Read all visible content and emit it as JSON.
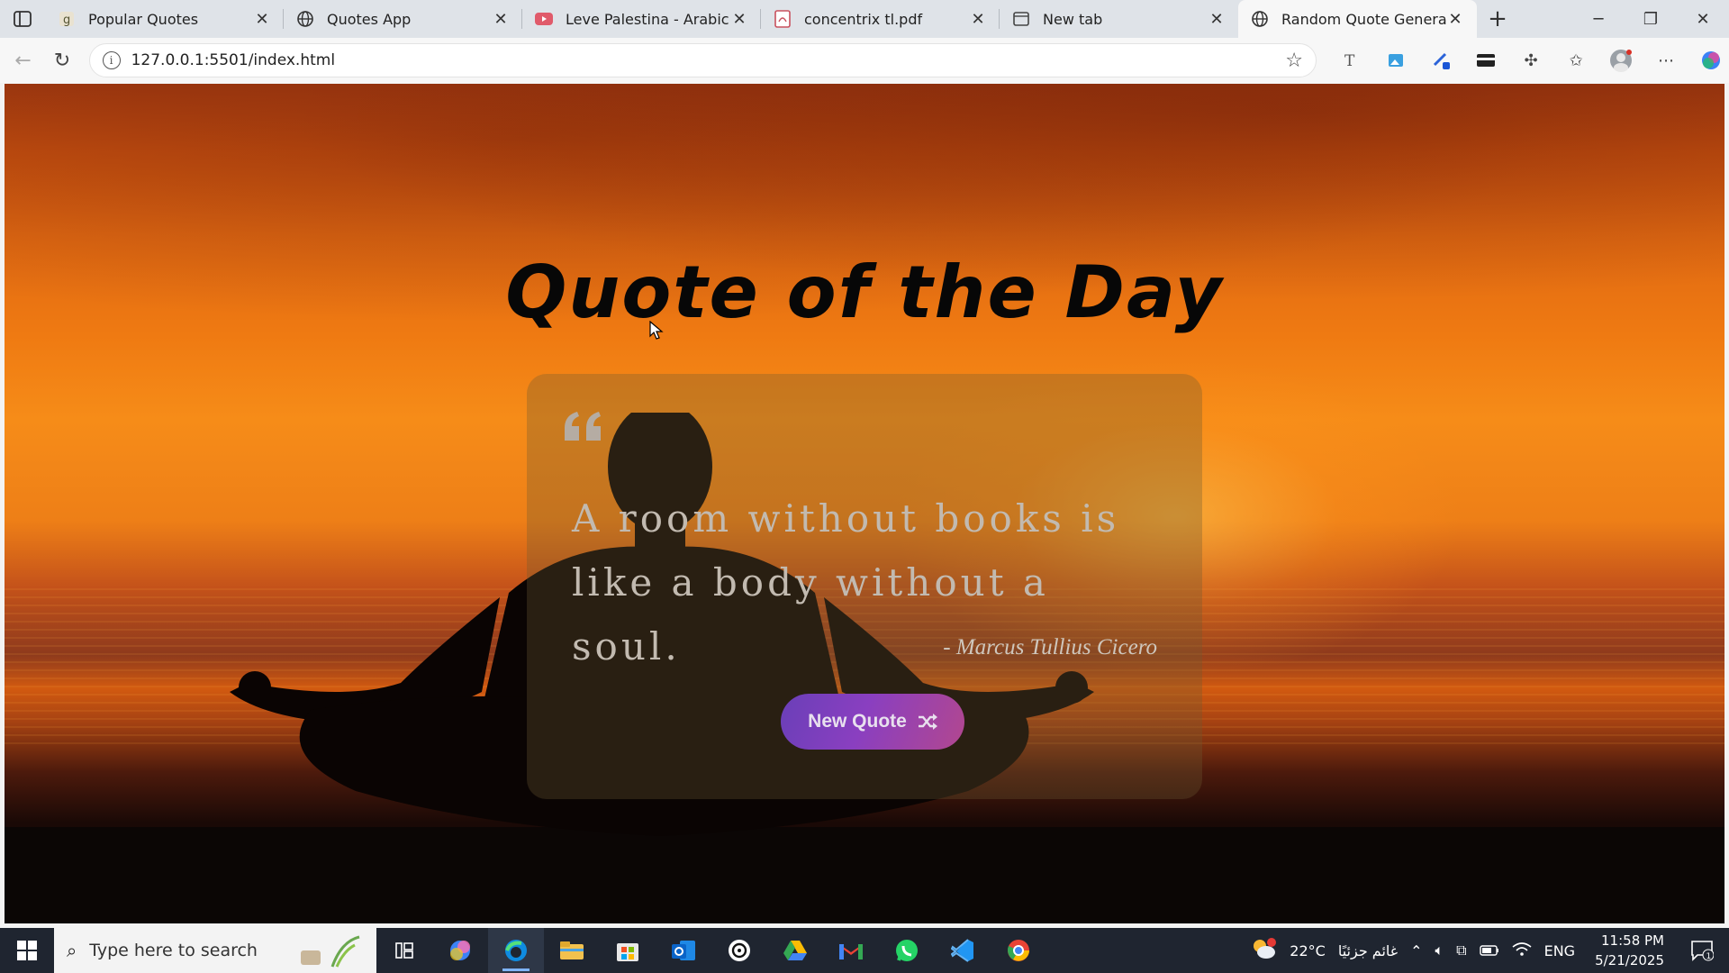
{
  "browser": {
    "tabs": [
      {
        "title": "Popular Quotes",
        "favicon": "goodreads-icon",
        "active": false
      },
      {
        "title": "Quotes App",
        "favicon": "globe-icon",
        "active": false
      },
      {
        "title": "Leve Palestina - Arabic Trap M",
        "favicon": "youtube-icon",
        "active": false
      },
      {
        "title": "concentrix tl.pdf",
        "favicon": "pdf-icon",
        "active": false
      },
      {
        "title": "New tab",
        "favicon": "newtab-icon",
        "active": false
      },
      {
        "title": "Random Quote Generator",
        "favicon": "globe-icon",
        "active": true
      }
    ],
    "url": "127.0.0.1:5501/index.html"
  },
  "page": {
    "heading": "Quote of the Day",
    "quote": "A room without books is like a body without a soul.",
    "author": "- Marcus Tullius Cicero",
    "button_label": "New Quote"
  },
  "taskbar": {
    "search_placeholder": "Type here to search",
    "weather_temp": "22°C",
    "weather_desc": "غائم جزئيًا",
    "language": "ENG",
    "time": "11:58 PM",
    "date": "5/21/2025",
    "notification_count": "1"
  },
  "colors": {
    "button_gradient_start": "#6a3fb8",
    "button_gradient_end": "#b2478f",
    "taskbar": "#1f2530"
  }
}
